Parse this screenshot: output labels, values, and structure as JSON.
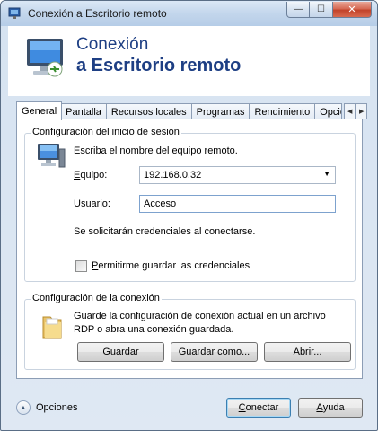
{
  "window": {
    "title": "Conexión a Escritorio remoto",
    "caption_minimize": "—",
    "caption_maximize": "☐",
    "caption_close": "✕"
  },
  "banner": {
    "line1": "Conexión",
    "line2": "a Escritorio remoto"
  },
  "tabs": [
    {
      "label": "General",
      "active": true
    },
    {
      "label": "Pantalla"
    },
    {
      "label": "Recursos locales"
    },
    {
      "label": "Programas"
    },
    {
      "label": "Rendimiento"
    },
    {
      "label": "Opcio"
    }
  ],
  "tab_scroll": {
    "left": "◀",
    "right": "▶"
  },
  "login_group": {
    "title": "Configuración del inicio de sesión",
    "instruction": "Escriba el nombre del equipo remoto.",
    "computer_label_ul": "E",
    "computer_label_rest": "quipo:",
    "computer_value": "192.168.0.32",
    "combo_arrow": "▼",
    "user_label": "Usuario:",
    "user_value": "Acceso",
    "credentials_note": "Se solicitarán credenciales al conectarse.",
    "remember_ul": "P",
    "remember_rest": "ermitirme guardar las credenciales",
    "remember_checked": false
  },
  "connection_group": {
    "title": "Configuración de la conexión",
    "description_line1": "Guarde la configuración de conexión actual en un archivo",
    "description_line2": "RDP o abra una conexión guardada.",
    "save_ul": "G",
    "save_rest": "uardar",
    "save_as_pre": "Guardar ",
    "save_as_ul": "c",
    "save_as_post": "omo...",
    "open_ul": "A",
    "open_rest": "brir..."
  },
  "footer": {
    "options_label": "Opciones",
    "options_icon": "▲",
    "connect_ul": "C",
    "connect_rest": "onectar",
    "help_ul": "A",
    "help_rest": "yuda"
  }
}
